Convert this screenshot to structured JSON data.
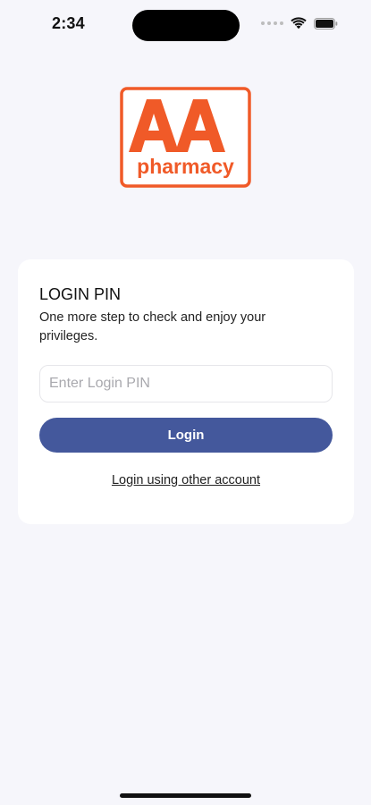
{
  "status_bar": {
    "time": "2:34",
    "icons": [
      "signal-dots-icon",
      "wifi-icon",
      "battery-icon"
    ]
  },
  "logo": {
    "letters": "AA",
    "word": "pharmacy",
    "brand_color": "#f05a28"
  },
  "login_card": {
    "title": "LOGIN PIN",
    "subtitle": "One more step to check and enjoy your privileges.",
    "pin_input": {
      "placeholder": "Enter Login PIN",
      "value": ""
    },
    "login_button_label": "Login",
    "other_account_link": "Login using other account"
  },
  "colors": {
    "background": "#f6f6fb",
    "card": "#ffffff",
    "primary_button": "#44589c",
    "logo_orange": "#f05a28"
  }
}
